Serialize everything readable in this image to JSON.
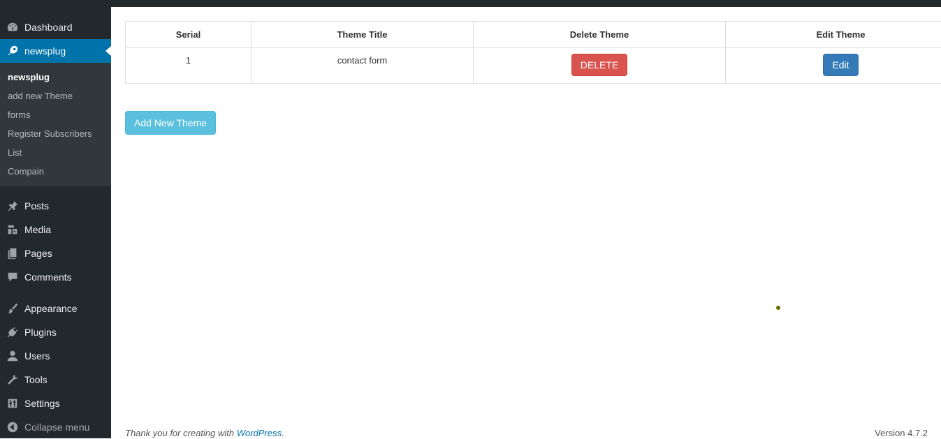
{
  "sidebar": {
    "dashboard": "Dashboard",
    "newsplug": "newsplug",
    "submenu": [
      "newsplug",
      "add new Theme",
      "forms",
      "Register Subscribers",
      "List",
      "Compain"
    ],
    "posts": "Posts",
    "media": "Media",
    "pages": "Pages",
    "comments": "Comments",
    "appearance": "Appearance",
    "plugins": "Plugins",
    "users": "Users",
    "tools": "Tools",
    "settings": "Settings",
    "collapse": "Collapse menu"
  },
  "table": {
    "headers": [
      "Serial",
      "Theme Title",
      "Delete Theme",
      "Edit Theme"
    ],
    "rows": [
      {
        "serial": "1",
        "title": "contact form",
        "delete_label": "DELETE",
        "edit_label": "Edit"
      }
    ]
  },
  "actions": {
    "add_new_theme": "Add New Theme"
  },
  "footer": {
    "thank_you": "Thank you for creating with ",
    "wp_link": "WordPress",
    "period": ".",
    "version": "Version 4.7.2"
  },
  "colors": {
    "sidebar": "#23282d",
    "active": "#0073aa",
    "danger": "#d9534f",
    "primary": "#337ab7",
    "info": "#5bc0de"
  }
}
